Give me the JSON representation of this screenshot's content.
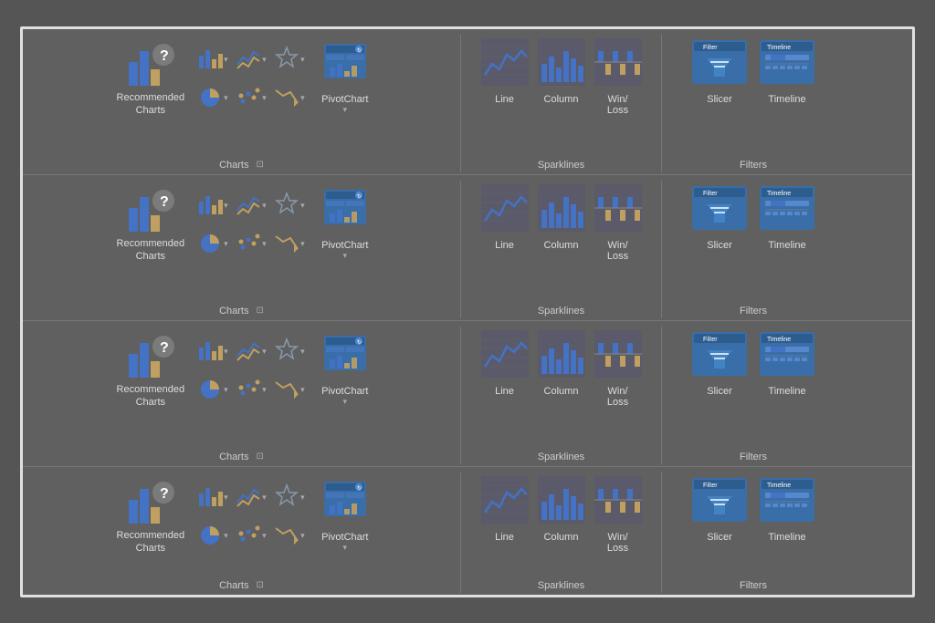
{
  "ribbon": {
    "rows": [
      {
        "id": "row1",
        "sections": [
          {
            "id": "recommended-charts",
            "label": "Charts",
            "type": "charts-main"
          },
          {
            "id": "sparklines",
            "label": "Sparklines",
            "type": "sparklines"
          },
          {
            "id": "filters",
            "label": "Filters",
            "type": "filters"
          }
        ]
      }
    ],
    "rowCount": 4,
    "recommendedCharts": {
      "label": "Recommended\nCharts"
    },
    "pivotChart": {
      "label": "PivotChart"
    },
    "sparklineItems": [
      {
        "label": "Line"
      },
      {
        "label": "Column"
      },
      {
        "label": "Win/\nLoss"
      }
    ],
    "filterItems": [
      {
        "label": "Slicer"
      },
      {
        "label": "Timeline"
      }
    ],
    "chartsLabel": "Charts",
    "sparklinesLabel": "Sparklines",
    "filtersLabel": "Filters"
  }
}
